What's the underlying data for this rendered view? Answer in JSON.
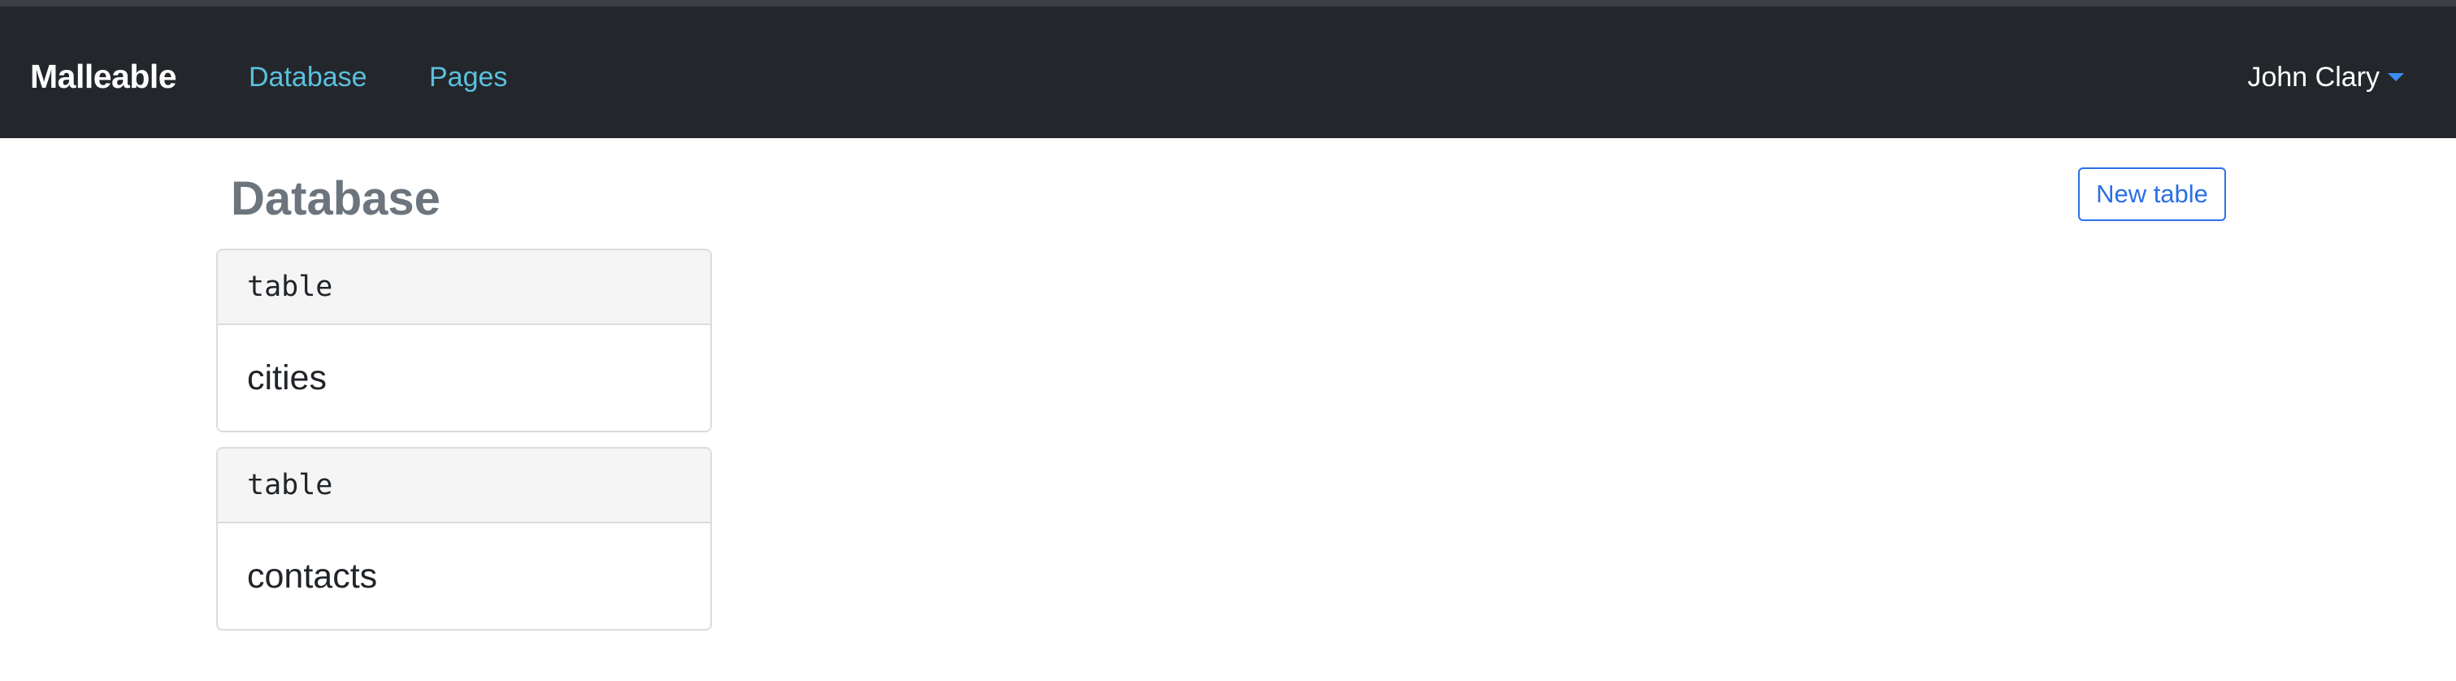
{
  "navbar": {
    "brand": "Malleable",
    "links": [
      {
        "label": "Database"
      },
      {
        "label": "Pages"
      }
    ],
    "user": {
      "name": "John Clary",
      "icon": "caret-down-icon"
    }
  },
  "main": {
    "title": "Database",
    "new_table_label": "New table",
    "cards": [
      {
        "type": "table",
        "name": "cities"
      },
      {
        "type": "table",
        "name": "contacts"
      }
    ]
  },
  "colors": {
    "navbar_bg": "#23272b",
    "nav_link": "#5bc0de",
    "accent": "#2b6fe8",
    "title": "#6c757d"
  }
}
